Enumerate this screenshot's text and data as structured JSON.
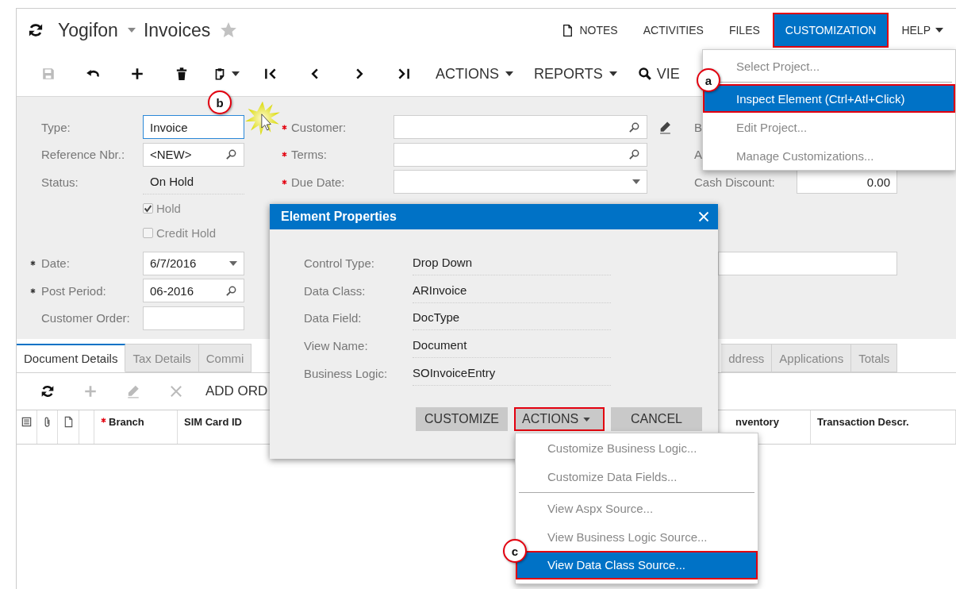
{
  "header": {
    "company": "Yogifon",
    "screen": "Invoices",
    "favorite": false
  },
  "top_links": [
    {
      "label": "NOTES",
      "kind": "note",
      "selected": false,
      "highlighted": false
    },
    {
      "label": "ACTIVITIES",
      "kind": "plain",
      "selected": false,
      "highlighted": false
    },
    {
      "label": "FILES",
      "kind": "plain",
      "selected": false,
      "highlighted": false
    },
    {
      "label": "CUSTOMIZATION",
      "kind": "plain",
      "selected": true,
      "highlighted": true
    },
    {
      "label": "HELP",
      "kind": "menu",
      "selected": false,
      "highlighted": false
    }
  ],
  "toolbar": {
    "icons": [
      {
        "kind": "save",
        "disabled": true
      },
      {
        "kind": "undo",
        "disabled": false
      },
      {
        "kind": "plus",
        "disabled": false
      },
      {
        "kind": "trash",
        "disabled": false
      },
      {
        "kind": "clipboard",
        "disabled": false
      },
      {
        "kind": "first",
        "disabled": false
      },
      {
        "kind": "prev",
        "disabled": false
      },
      {
        "kind": "next",
        "disabled": false
      },
      {
        "kind": "last",
        "disabled": false
      }
    ],
    "menus": [
      {
        "label": "ACTIONS"
      },
      {
        "label": "REPORTS"
      }
    ],
    "search_label": "VIE"
  },
  "form": {
    "upper": {
      "left": [
        {
          "kind": "text-field",
          "label": "Type:",
          "value": "Invoice",
          "required": false,
          "focused": true
        },
        {
          "kind": "lookup",
          "label": "Reference Nbr.:",
          "value": "<NEW>",
          "required": false,
          "focused": false
        },
        {
          "kind": "text",
          "label": "Status:",
          "value": "On Hold"
        },
        {
          "kind": "checkbox",
          "label": "Hold",
          "checked": true
        },
        {
          "kind": "checkbox",
          "label": "Credit Hold",
          "checked": false
        }
      ],
      "middle": [
        {
          "kind": "lookup-edit",
          "label": "Customer:",
          "required": true,
          "focused": false
        },
        {
          "kind": "lookup",
          "label": "Terms:",
          "required": true,
          "focused": false
        },
        {
          "kind": "dropdown",
          "label": "Due Date:",
          "required": true,
          "focused": false
        }
      ],
      "right": [
        {
          "kind": "label",
          "label": "B"
        },
        {
          "kind": "label",
          "label": "A"
        },
        {
          "kind": "number",
          "label": "Cash Discount:",
          "value": "0.00"
        }
      ]
    },
    "lower": {
      "left": [
        {
          "kind": "dropdown",
          "label": "Date:",
          "value": "6/7/2016",
          "required": true,
          "focused": false
        },
        {
          "kind": "lookup",
          "label": "Post Period:",
          "value": "06-2016",
          "required": true,
          "focused": false
        },
        {
          "kind": "text-field",
          "label": "Customer Order:",
          "required": false,
          "focused": false
        }
      ],
      "right": [
        {
          "kind": "text-field",
          "required": false,
          "focused": false
        }
      ]
    }
  },
  "tabs": {
    "left": [
      {
        "label": "Document Details",
        "selected": true
      },
      {
        "label": "Tax Details",
        "selected": false
      },
      {
        "label": "Commi",
        "selected": false
      }
    ],
    "right": [
      {
        "label": "ddress",
        "selected": false
      },
      {
        "label": "Applications",
        "selected": false
      },
      {
        "label": "Totals",
        "selected": false
      }
    ]
  },
  "grid_toolbar": {
    "icons": [
      {
        "kind": "refresh",
        "disabled": false
      },
      {
        "kind": "plus",
        "disabled": true
      },
      {
        "kind": "pencil",
        "disabled": true
      },
      {
        "kind": "close",
        "disabled": true
      }
    ],
    "label": "ADD ORD"
  },
  "grid": {
    "columns_left": [
      {
        "label": "Branch",
        "required": true
      },
      {
        "label": "SIM Card ID",
        "required": false
      }
    ],
    "columns_right": [
      {
        "label": "nventory",
        "required": false
      },
      {
        "label": "Transaction Descr.",
        "required": false
      }
    ]
  },
  "customization_menu": [
    {
      "label": "Select Project...",
      "selected": false,
      "highlighted": false
    },
    {
      "label": "Inspect Element (Ctrl+Atl+Click)",
      "selected": true,
      "highlighted": true
    },
    {
      "label": "Edit Project...",
      "selected": false,
      "highlighted": false
    },
    {
      "label": "Manage Customizations...",
      "selected": false,
      "highlighted": false
    }
  ],
  "dialog": {
    "title": "Element Properties",
    "properties": [
      {
        "label": "Control Type:",
        "value": "Drop Down"
      },
      {
        "label": "Data Class:",
        "value": "ARInvoice"
      },
      {
        "label": "Data Field:",
        "value": "DocType"
      },
      {
        "label": "View Name:",
        "value": "Document"
      },
      {
        "label": "Business Logic:",
        "value": "SOInvoiceEntry"
      }
    ],
    "buttons": [
      {
        "label": "CUSTOMIZE",
        "kind": "plain",
        "highlighted": false
      },
      {
        "label": "ACTIONS",
        "kind": "menu",
        "highlighted": true
      },
      {
        "label": "CANCEL",
        "kind": "plain",
        "highlighted": false
      }
    ]
  },
  "actions_menu": [
    [
      {
        "label": "Customize Business Logic...",
        "selected": false,
        "highlighted": false
      },
      {
        "label": "Customize Data Fields...",
        "selected": false,
        "highlighted": false
      }
    ],
    [
      {
        "label": "View Aspx Source...",
        "selected": false,
        "highlighted": false
      },
      {
        "label": "View Business Logic Source...",
        "selected": false,
        "highlighted": false
      },
      {
        "label": "View Data Class Source...",
        "selected": true,
        "highlighted": true
      }
    ]
  ],
  "callouts": [
    {
      "label": "a"
    },
    {
      "label": "b"
    },
    {
      "label": "c"
    }
  ]
}
